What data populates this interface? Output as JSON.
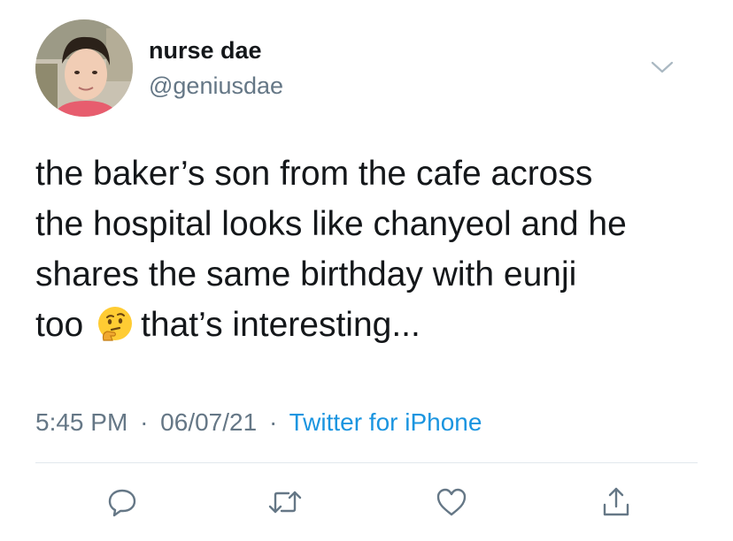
{
  "user": {
    "display_name": "nurse dae",
    "handle": "@geniusdae"
  },
  "tweet": {
    "lines": [
      "the baker’s son from the cafe across",
      "the hospital looks like chanyeol and he",
      "shares the same birthday with eunji"
    ],
    "last_line_before_emoji": "too",
    "emoji": "thinking-face",
    "last_line_after_emoji": "that’s interesting..."
  },
  "meta": {
    "time": "5:45 PM",
    "separator": "·",
    "date": "06/07/21",
    "source": "Twitter for iPhone"
  },
  "actions": [
    "reply-icon",
    "retweet-icon",
    "like-icon",
    "share-icon"
  ],
  "colors": {
    "text": "#14171a",
    "muted": "#657786",
    "link": "#1b95e0",
    "divider": "#e1e8ed"
  }
}
